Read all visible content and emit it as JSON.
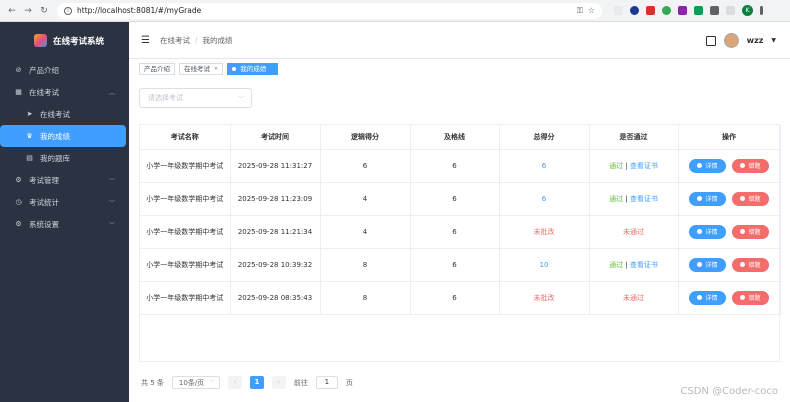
{
  "browser": {
    "url": "http://localhost:8081/#/myGrade",
    "profile_initial": "K"
  },
  "sidebar": {
    "title": "在线考试系统",
    "items": [
      {
        "label": "产品介绍",
        "icon": "compass-icon"
      },
      {
        "label": "在线考试",
        "icon": "grid-icon"
      },
      {
        "label": "在线考试",
        "icon": "send-icon"
      },
      {
        "label": "我的成绩",
        "icon": "trophy-icon"
      },
      {
        "label": "我的题库",
        "icon": "book-icon"
      },
      {
        "label": "考试管理",
        "icon": "gear-icon"
      },
      {
        "label": "考试统计",
        "icon": "clock-icon"
      },
      {
        "label": "系统设置",
        "icon": "settings-icon"
      }
    ]
  },
  "header": {
    "breadcrumb": [
      "在线考试",
      "我的成绩"
    ],
    "username": "wzz"
  },
  "tags": [
    "产品介绍",
    "在线考试",
    "我的成绩"
  ],
  "filter": {
    "placeholder": "请选择考试"
  },
  "table": {
    "headers": [
      "考试名称",
      "考试时间",
      "逻辑得分",
      "及格线",
      "总得分",
      "是否通过",
      "操作"
    ],
    "rows": [
      {
        "name": "小学一年级数学期中考试",
        "time": "2025-09-28 11:31:27",
        "logic": "6",
        "pass_line": "6",
        "total": "6",
        "passed": "通过",
        "cert": "查看证书"
      },
      {
        "name": "小学一年级数学期中考试",
        "time": "2025-09-28 11:23:09",
        "logic": "4",
        "pass_line": "6",
        "total": "6",
        "passed": "通过",
        "cert": "查看证书"
      },
      {
        "name": "小学一年级数学期中考试",
        "time": "2025-09-28 11:21:34",
        "logic": "4",
        "pass_line": "6",
        "total": "未批改",
        "passed": "未通过",
        "cert": ""
      },
      {
        "name": "小学一年级数学期中考试",
        "time": "2025-09-28 10:39:32",
        "logic": "8",
        "pass_line": "6",
        "total": "10",
        "passed": "通过",
        "cert": "查看证书"
      },
      {
        "name": "小学一年级数学期中考试",
        "time": "2025-09-28 08:35:43",
        "logic": "8",
        "pass_line": "6",
        "total": "未批改",
        "passed": "未通过",
        "cert": ""
      }
    ],
    "detail_label": "详情",
    "wrong_label": "错题",
    "cert_sep": "|"
  },
  "pagination": {
    "total": "共 5 条",
    "page_size": "10条/页",
    "current": "1",
    "goto_prefix": "前往",
    "goto_value": "1",
    "goto_suffix": "页"
  },
  "watermark": "CSDN @Coder-coco"
}
